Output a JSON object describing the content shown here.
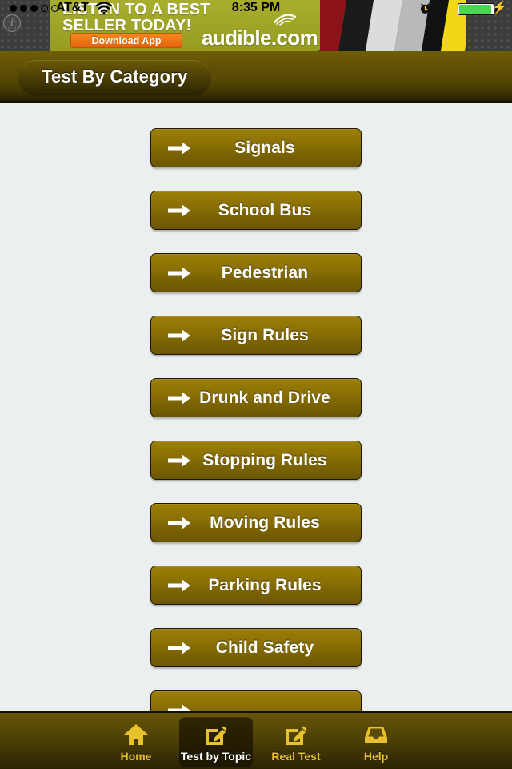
{
  "status_bar": {
    "signal_dots_filled": 3,
    "signal_dots_total": 5,
    "carrier": "AT&T",
    "wifi_icon": "wifi-icon",
    "time": "8:35 PM",
    "alarm_icon": "alarm-clock-icon",
    "bluetooth_icon": "bluetooth-icon",
    "battery_icon": "battery-icon",
    "battery_charging_icon": "charging-bolt-icon",
    "battery_color": "#4cd551"
  },
  "ad": {
    "info_badge": "i",
    "headline_line1": "LISTEN TO A BEST",
    "headline_line2": "SELLER TODAY!",
    "cta_label": "Download App",
    "brand": "audible.com",
    "logo_icon": "audible-logo-icon",
    "background_color": "#a2a829",
    "cta_color": "#e2620d"
  },
  "nav": {
    "title": "Test By Category"
  },
  "categories": [
    {
      "label": "Signals",
      "icon": "arrow-right-icon"
    },
    {
      "label": "School Bus",
      "icon": "arrow-right-icon"
    },
    {
      "label": "Pedestrian",
      "icon": "arrow-right-icon"
    },
    {
      "label": "Sign Rules",
      "icon": "arrow-right-icon"
    },
    {
      "label": "Drunk and Drive",
      "icon": "arrow-right-icon"
    },
    {
      "label": "Stopping Rules",
      "icon": "arrow-right-icon"
    },
    {
      "label": "Moving Rules",
      "icon": "arrow-right-icon"
    },
    {
      "label": "Parking Rules",
      "icon": "arrow-right-icon"
    },
    {
      "label": "Child Safety",
      "icon": "arrow-right-icon"
    },
    {
      "label": "",
      "icon": "arrow-right-icon"
    }
  ],
  "tabs": [
    {
      "label": "Home",
      "icon": "home-icon",
      "selected": false
    },
    {
      "label": "Test by Topic",
      "icon": "compose-icon",
      "selected": true
    },
    {
      "label": "Real Test",
      "icon": "compose-icon",
      "selected": false
    },
    {
      "label": "Help",
      "icon": "inbox-icon",
      "selected": false
    }
  ],
  "theme": {
    "button_gold_top": "#9c7f06",
    "button_gold_bottom": "#6b5604",
    "chrome_olive": "#665506",
    "content_background": "#eceff0",
    "tab_accent": "#e8c22c"
  }
}
